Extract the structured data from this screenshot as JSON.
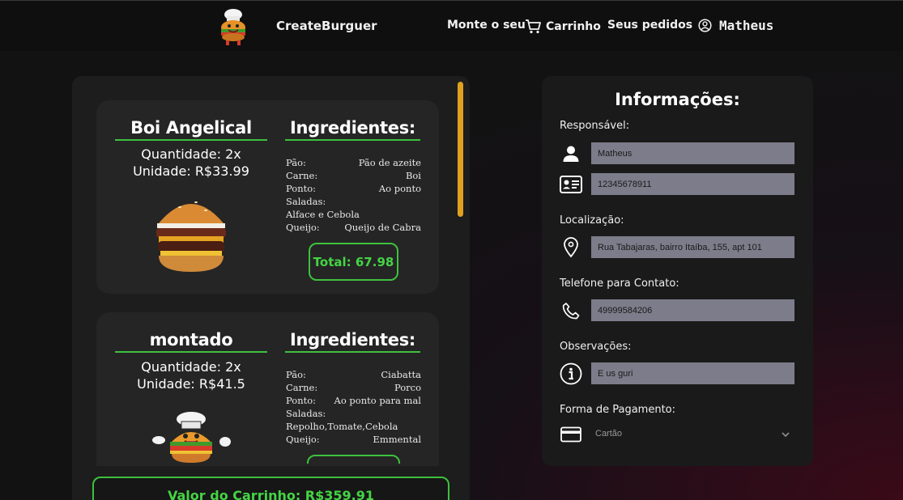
{
  "nav": {
    "brand": "CreateBurguer",
    "monte": "Monte o seu",
    "cart": "Carrinho",
    "orders": "Seus pedidos",
    "user": "Matheus"
  },
  "items": [
    {
      "name": "Boi Angelical",
      "quantity": "Quantidade: 2x",
      "unit": "Unidade: R$33.99",
      "ing_title": "Ingredientes:",
      "ingredients": [
        {
          "k": "Pão:",
          "v": "Pão de azeite"
        },
        {
          "k": "Carne:",
          "v": "Boi"
        },
        {
          "k": "Ponto:",
          "v": "Ao ponto"
        },
        {
          "k": "Saladas:",
          "v": ""
        },
        {
          "k": "Alface e Cebola",
          "v": ""
        },
        {
          "k": "Queijo:",
          "v": "Queijo de Cabra"
        }
      ],
      "total": "Total: 67.98"
    },
    {
      "name": "montado",
      "quantity": "Quantidade: 2x",
      "unit": "Unidade: R$41.5",
      "ing_title": "Ingredientes:",
      "ingredients": [
        {
          "k": "Pão:",
          "v": "Ciabatta"
        },
        {
          "k": "Carne:",
          "v": "Porco"
        },
        {
          "k": "Ponto:",
          "v": "Ao ponto para mal"
        },
        {
          "k": "Saladas:",
          "v": ""
        },
        {
          "k": "Repolho,Tomate,Cebola",
          "v": ""
        },
        {
          "k": "Queijo:",
          "v": "Emmental"
        }
      ]
    }
  ],
  "cart_total": "Valor do Carrinho: R$359.91",
  "info": {
    "title": "Informações:",
    "responsavel_label": "Responsável:",
    "name_value": "Matheus",
    "cpf_value": "12345678911",
    "localizacao_label": "Localização:",
    "address_value": "Rua Tabajaras, bairro Itaíba, 155, apt 101",
    "telefone_label": "Telefone para Contato:",
    "phone_value": "49999584206",
    "observacoes_label": "Observações:",
    "obs_value": "E us guri",
    "pagamento_label": "Forma de Pagamento:",
    "pagamento_value": "Cartão"
  },
  "colors": {
    "accent": "#3ec13e",
    "scroll": "#e0a020",
    "input_bg": "#7c7c8a"
  }
}
